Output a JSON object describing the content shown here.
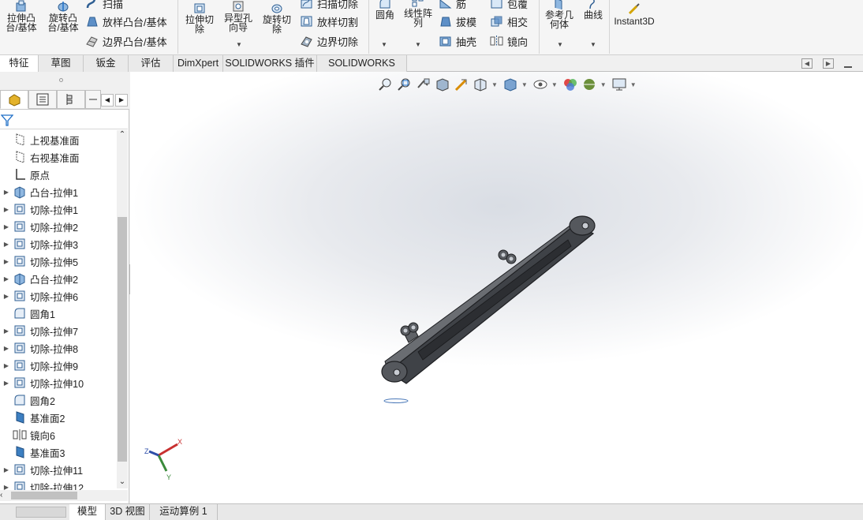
{
  "ribbon": {
    "buttons": [
      {
        "name": "extruded-boss",
        "label": "拉伸凸\n台/基体"
      },
      {
        "name": "revolved-boss",
        "label": "旋转凸\n台/基体"
      },
      {
        "name": "extruded-cut",
        "label": "拉伸切\n除"
      },
      {
        "name": "hole-wizard",
        "label": "异型孔\n向导"
      },
      {
        "name": "revolved-cut",
        "label": "旋转切\n除"
      },
      {
        "name": "fillet",
        "label": "圆角"
      },
      {
        "name": "linear-pattern",
        "label": "线性阵\n列"
      },
      {
        "name": "reference-geometry",
        "label": "参考几\n何体"
      },
      {
        "name": "curves",
        "label": "曲线"
      },
      {
        "name": "instant3d",
        "label": "Instant3D"
      }
    ],
    "small": [
      {
        "name": "sweep",
        "label": "扫描"
      },
      {
        "name": "loft-boss",
        "label": "放样凸台/基体"
      },
      {
        "name": "boundary-boss",
        "label": "边界凸台/基体"
      },
      {
        "name": "swept-cut",
        "label": "扫描切除"
      },
      {
        "name": "lofted-cut",
        "label": "放样切割"
      },
      {
        "name": "boundary-cut",
        "label": "边界切除"
      },
      {
        "name": "rib",
        "label": "筋"
      },
      {
        "name": "draft",
        "label": "拔模"
      },
      {
        "name": "shell",
        "label": "抽壳"
      },
      {
        "name": "wrap",
        "label": "包覆"
      },
      {
        "name": "intersect",
        "label": "相交"
      },
      {
        "name": "mirror",
        "label": "镜向"
      }
    ]
  },
  "tabs": [
    "特征",
    "草图",
    "钣金",
    "评估",
    "DimXpert",
    "SOLIDWORKS 插件",
    "SOLIDWORKS MBD"
  ],
  "tree": [
    {
      "label": "上视基准面",
      "icon": "plane-icon",
      "expandable": false
    },
    {
      "label": "右视基准面",
      "icon": "plane-icon",
      "expandable": false
    },
    {
      "label": "原点",
      "icon": "origin-icon",
      "expandable": false
    },
    {
      "label": "凸台-拉伸1",
      "icon": "boss-extrude-icon",
      "expandable": true
    },
    {
      "label": "切除-拉伸1",
      "icon": "cut-extrude-icon",
      "expandable": true
    },
    {
      "label": "切除-拉伸2",
      "icon": "cut-extrude-icon",
      "expandable": true
    },
    {
      "label": "切除-拉伸3",
      "icon": "cut-extrude-icon",
      "expandable": true
    },
    {
      "label": "切除-拉伸5",
      "icon": "cut-extrude-icon",
      "expandable": true
    },
    {
      "label": "凸台-拉伸2",
      "icon": "boss-extrude-icon",
      "expandable": true
    },
    {
      "label": "切除-拉伸6",
      "icon": "cut-extrude-icon",
      "expandable": true
    },
    {
      "label": "圆角1",
      "icon": "fillet-icon",
      "expandable": false
    },
    {
      "label": "切除-拉伸7",
      "icon": "cut-extrude-icon",
      "expandable": true
    },
    {
      "label": "切除-拉伸8",
      "icon": "cut-extrude-icon",
      "expandable": true
    },
    {
      "label": "切除-拉伸9",
      "icon": "cut-extrude-icon",
      "expandable": true
    },
    {
      "label": "切除-拉伸10",
      "icon": "cut-extrude-icon",
      "expandable": true
    },
    {
      "label": "圆角2",
      "icon": "fillet-icon",
      "expandable": false
    },
    {
      "label": "基准面2",
      "icon": "plane-solid-icon",
      "expandable": false
    },
    {
      "label": "镜向6",
      "icon": "mirror-icon",
      "expandable": false
    },
    {
      "label": "基准面3",
      "icon": "plane-solid-icon",
      "expandable": false
    },
    {
      "label": "切除-拉伸11",
      "icon": "cut-extrude-icon",
      "expandable": true
    },
    {
      "label": "切除-拉伸12",
      "icon": "cut-extrude-icon",
      "expandable": true
    }
  ],
  "triad": {
    "x": "X",
    "y": "Y",
    "z": "Z"
  },
  "bottom_tabs": [
    "模型",
    "3D 视图",
    "运动算例 1"
  ],
  "colors": {
    "accent": "#1f6fc7",
    "model": "#4a4d52"
  }
}
